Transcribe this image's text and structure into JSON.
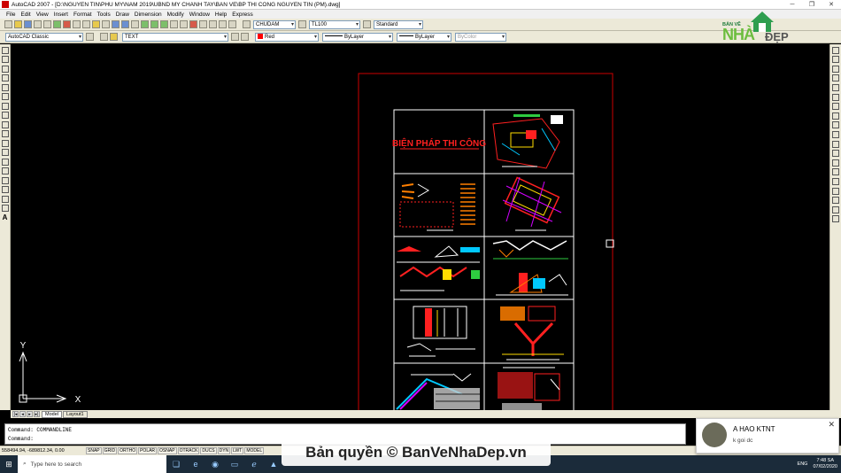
{
  "window": {
    "title": "AutoCAD 2007 - [D:\\NGUYEN TIN\\PHU MY\\NAM 2019\\UBND MY CHANH TAY\\BAN VE\\BP THI CONG NGUYEN TIN (PM).dwg]",
    "minimize": "─",
    "restore": "❐",
    "close": "✕"
  },
  "menu": [
    "File",
    "Edit",
    "View",
    "Insert",
    "Format",
    "Tools",
    "Draw",
    "Dimension",
    "Modify",
    "Window",
    "Help",
    "Express"
  ],
  "toolbar1": {
    "text_style": "CHUDAM",
    "dim_style": "TL100",
    "table_style": "Standard"
  },
  "toolbar2": {
    "workspace": "AutoCAD Classic",
    "layer": "TEXT",
    "color": "Red",
    "linetype": "ByLayer",
    "lineweight": "ByLayer",
    "plotstyle": "ByColor"
  },
  "logo": {
    "top": "BẢN VẼ",
    "main": "NHÀ",
    "suffix": "ĐẸP"
  },
  "drawing": {
    "title": "BIỆN PHÁP THI CÔNG"
  },
  "ucs": {
    "x": "X",
    "y": "Y"
  },
  "tabs": {
    "model": "Model",
    "layout": "Layout1"
  },
  "command": {
    "line1": "Command: COMMANDLINE",
    "line2": "Command:"
  },
  "status": {
    "coords": "558494.94, -689812.34, 0.00",
    "buttons": [
      "SNAP",
      "GRID",
      "ORTHO",
      "POLAR",
      "OSNAP",
      "OTRACK",
      "DUCS",
      "DYN",
      "LWT",
      "MODEL"
    ]
  },
  "watermark": "Bản quyền © BanVeNhaDep.vn",
  "notification": {
    "name": "A HAO KTNT",
    "message": "k goi dc",
    "close": "✕"
  },
  "taskbar": {
    "search_placeholder": "Type here to search",
    "language": "ENG",
    "time": "7:48 SA",
    "date": "07/02/2020"
  },
  "colors": {
    "canvas": "#000000",
    "drawing_red": "#ff2020",
    "sheet_border": "#ffffff",
    "accent_green": "#6cbd3f"
  }
}
